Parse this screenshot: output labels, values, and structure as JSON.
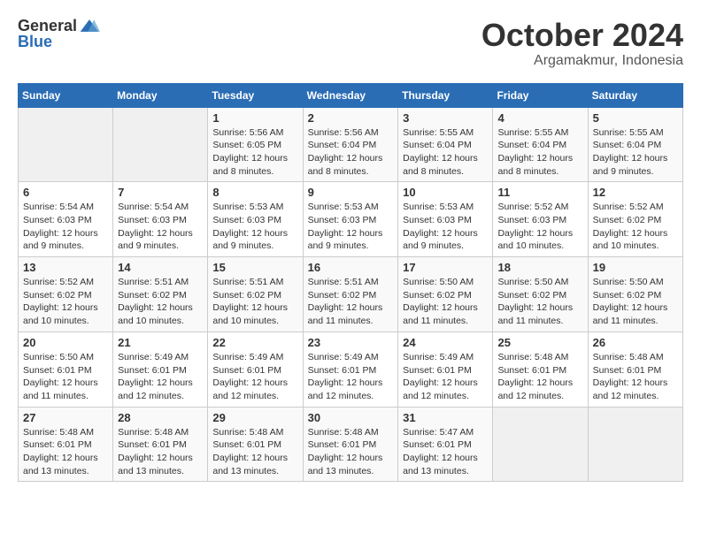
{
  "header": {
    "logo_general": "General",
    "logo_blue": "Blue",
    "month": "October 2024",
    "location": "Argamakmur, Indonesia"
  },
  "days_of_week": [
    "Sunday",
    "Monday",
    "Tuesday",
    "Wednesday",
    "Thursday",
    "Friday",
    "Saturday"
  ],
  "weeks": [
    [
      {
        "day": "",
        "empty": true
      },
      {
        "day": "",
        "empty": true
      },
      {
        "day": "1",
        "sunrise": "Sunrise: 5:56 AM",
        "sunset": "Sunset: 6:05 PM",
        "daylight": "Daylight: 12 hours and 8 minutes."
      },
      {
        "day": "2",
        "sunrise": "Sunrise: 5:56 AM",
        "sunset": "Sunset: 6:04 PM",
        "daylight": "Daylight: 12 hours and 8 minutes."
      },
      {
        "day": "3",
        "sunrise": "Sunrise: 5:55 AM",
        "sunset": "Sunset: 6:04 PM",
        "daylight": "Daylight: 12 hours and 8 minutes."
      },
      {
        "day": "4",
        "sunrise": "Sunrise: 5:55 AM",
        "sunset": "Sunset: 6:04 PM",
        "daylight": "Daylight: 12 hours and 8 minutes."
      },
      {
        "day": "5",
        "sunrise": "Sunrise: 5:55 AM",
        "sunset": "Sunset: 6:04 PM",
        "daylight": "Daylight: 12 hours and 9 minutes."
      }
    ],
    [
      {
        "day": "6",
        "sunrise": "Sunrise: 5:54 AM",
        "sunset": "Sunset: 6:03 PM",
        "daylight": "Daylight: 12 hours and 9 minutes."
      },
      {
        "day": "7",
        "sunrise": "Sunrise: 5:54 AM",
        "sunset": "Sunset: 6:03 PM",
        "daylight": "Daylight: 12 hours and 9 minutes."
      },
      {
        "day": "8",
        "sunrise": "Sunrise: 5:53 AM",
        "sunset": "Sunset: 6:03 PM",
        "daylight": "Daylight: 12 hours and 9 minutes."
      },
      {
        "day": "9",
        "sunrise": "Sunrise: 5:53 AM",
        "sunset": "Sunset: 6:03 PM",
        "daylight": "Daylight: 12 hours and 9 minutes."
      },
      {
        "day": "10",
        "sunrise": "Sunrise: 5:53 AM",
        "sunset": "Sunset: 6:03 PM",
        "daylight": "Daylight: 12 hours and 9 minutes."
      },
      {
        "day": "11",
        "sunrise": "Sunrise: 5:52 AM",
        "sunset": "Sunset: 6:03 PM",
        "daylight": "Daylight: 12 hours and 10 minutes."
      },
      {
        "day": "12",
        "sunrise": "Sunrise: 5:52 AM",
        "sunset": "Sunset: 6:02 PM",
        "daylight": "Daylight: 12 hours and 10 minutes."
      }
    ],
    [
      {
        "day": "13",
        "sunrise": "Sunrise: 5:52 AM",
        "sunset": "Sunset: 6:02 PM",
        "daylight": "Daylight: 12 hours and 10 minutes."
      },
      {
        "day": "14",
        "sunrise": "Sunrise: 5:51 AM",
        "sunset": "Sunset: 6:02 PM",
        "daylight": "Daylight: 12 hours and 10 minutes."
      },
      {
        "day": "15",
        "sunrise": "Sunrise: 5:51 AM",
        "sunset": "Sunset: 6:02 PM",
        "daylight": "Daylight: 12 hours and 10 minutes."
      },
      {
        "day": "16",
        "sunrise": "Sunrise: 5:51 AM",
        "sunset": "Sunset: 6:02 PM",
        "daylight": "Daylight: 12 hours and 11 minutes."
      },
      {
        "day": "17",
        "sunrise": "Sunrise: 5:50 AM",
        "sunset": "Sunset: 6:02 PM",
        "daylight": "Daylight: 12 hours and 11 minutes."
      },
      {
        "day": "18",
        "sunrise": "Sunrise: 5:50 AM",
        "sunset": "Sunset: 6:02 PM",
        "daylight": "Daylight: 12 hours and 11 minutes."
      },
      {
        "day": "19",
        "sunrise": "Sunrise: 5:50 AM",
        "sunset": "Sunset: 6:02 PM",
        "daylight": "Daylight: 12 hours and 11 minutes."
      }
    ],
    [
      {
        "day": "20",
        "sunrise": "Sunrise: 5:50 AM",
        "sunset": "Sunset: 6:01 PM",
        "daylight": "Daylight: 12 hours and 11 minutes."
      },
      {
        "day": "21",
        "sunrise": "Sunrise: 5:49 AM",
        "sunset": "Sunset: 6:01 PM",
        "daylight": "Daylight: 12 hours and 12 minutes."
      },
      {
        "day": "22",
        "sunrise": "Sunrise: 5:49 AM",
        "sunset": "Sunset: 6:01 PM",
        "daylight": "Daylight: 12 hours and 12 minutes."
      },
      {
        "day": "23",
        "sunrise": "Sunrise: 5:49 AM",
        "sunset": "Sunset: 6:01 PM",
        "daylight": "Daylight: 12 hours and 12 minutes."
      },
      {
        "day": "24",
        "sunrise": "Sunrise: 5:49 AM",
        "sunset": "Sunset: 6:01 PM",
        "daylight": "Daylight: 12 hours and 12 minutes."
      },
      {
        "day": "25",
        "sunrise": "Sunrise: 5:48 AM",
        "sunset": "Sunset: 6:01 PM",
        "daylight": "Daylight: 12 hours and 12 minutes."
      },
      {
        "day": "26",
        "sunrise": "Sunrise: 5:48 AM",
        "sunset": "Sunset: 6:01 PM",
        "daylight": "Daylight: 12 hours and 12 minutes."
      }
    ],
    [
      {
        "day": "27",
        "sunrise": "Sunrise: 5:48 AM",
        "sunset": "Sunset: 6:01 PM",
        "daylight": "Daylight: 12 hours and 13 minutes."
      },
      {
        "day": "28",
        "sunrise": "Sunrise: 5:48 AM",
        "sunset": "Sunset: 6:01 PM",
        "daylight": "Daylight: 12 hours and 13 minutes."
      },
      {
        "day": "29",
        "sunrise": "Sunrise: 5:48 AM",
        "sunset": "Sunset: 6:01 PM",
        "daylight": "Daylight: 12 hours and 13 minutes."
      },
      {
        "day": "30",
        "sunrise": "Sunrise: 5:48 AM",
        "sunset": "Sunset: 6:01 PM",
        "daylight": "Daylight: 12 hours and 13 minutes."
      },
      {
        "day": "31",
        "sunrise": "Sunrise: 5:47 AM",
        "sunset": "Sunset: 6:01 PM",
        "daylight": "Daylight: 12 hours and 13 minutes."
      },
      {
        "day": "",
        "empty": true
      },
      {
        "day": "",
        "empty": true
      }
    ]
  ]
}
